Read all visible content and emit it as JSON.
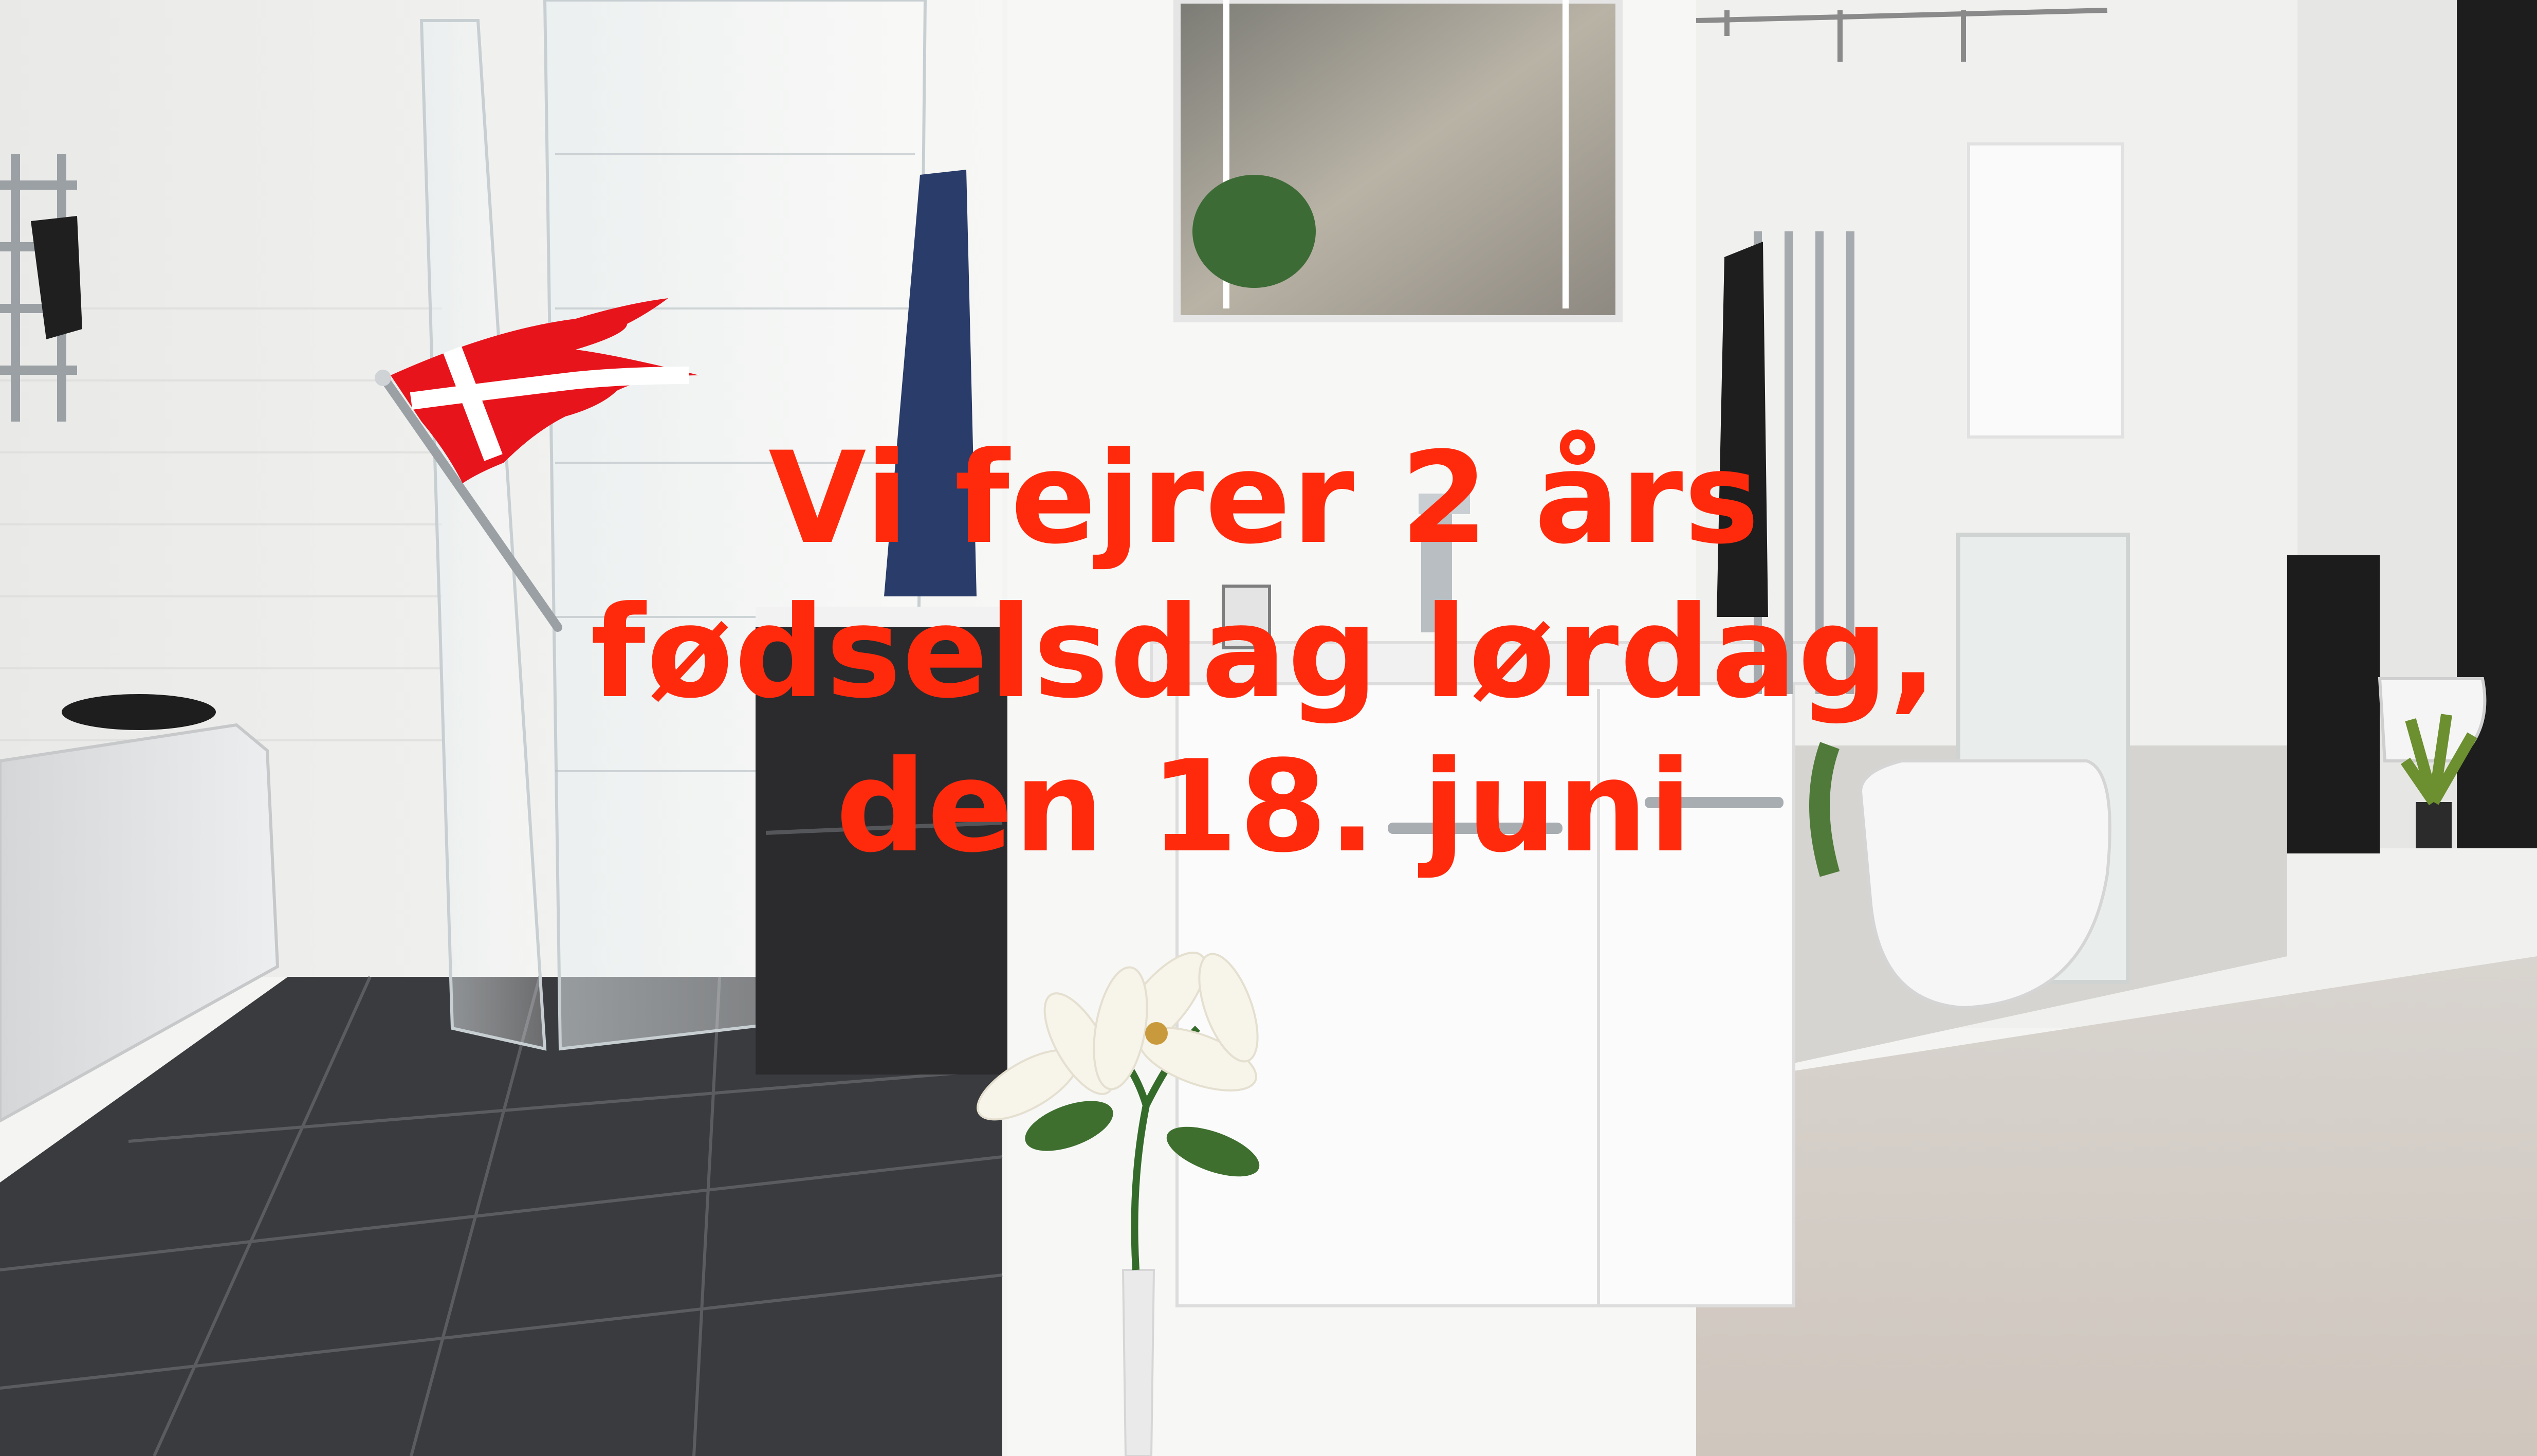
{
  "headline": {
    "line1": "Vi fejrer 2 års",
    "line2": "fødselsdag lørdag,",
    "line3": "den 18. juni"
  },
  "colors": {
    "headline_text": "#ff2a0c",
    "flag_red": "#e8141c",
    "flag_white": "#ffffff",
    "floor_tile": "#3a3b3e",
    "wall": "#f2f2f0",
    "floor_light": "#d8cfc6"
  },
  "icons": {
    "flag": "danish-pennant-flag-icon"
  }
}
